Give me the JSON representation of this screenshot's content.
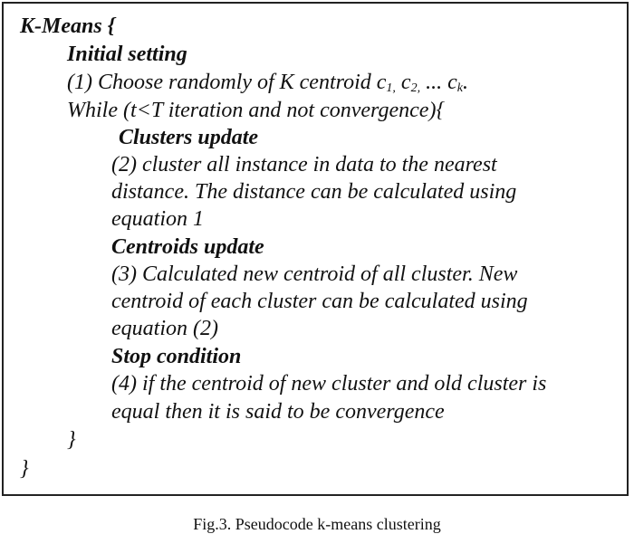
{
  "algorithm": {
    "header": "K-Means {",
    "initial_setting": "Initial setting",
    "step1_prefix": "(1) Choose randomly of K centroid c",
    "step1_sub1": "1,",
    "step1_mid1": " c",
    "step1_sub2": "2,",
    "step1_mid2": " ... c",
    "step1_sub3": "k",
    "step1_end": ".",
    "while_line": "While (t<T iteration and not convergence){",
    "clusters_update": "Clusters update",
    "step2_line1": "(2) cluster all instance in data to the nearest",
    "step2_line2": "distance. The distance can be calculated using",
    "step2_line3": "equation 1",
    "centroids_update": "Centroids update",
    "step3_line1": "(3) Calculated new centroid of all cluster. New",
    "step3_line2": "centroid of each cluster can be calculated using",
    "step3_line3": "equation (2)",
    "stop_condition": "Stop condition",
    "step4_line1": "(4) if the centroid of new cluster and old cluster is",
    "step4_line2": "equal then it is said to be convergence",
    "close_while": "}",
    "close_kmeans": "}"
  },
  "caption": "Fig.3. Pseudocode k-means clustering"
}
